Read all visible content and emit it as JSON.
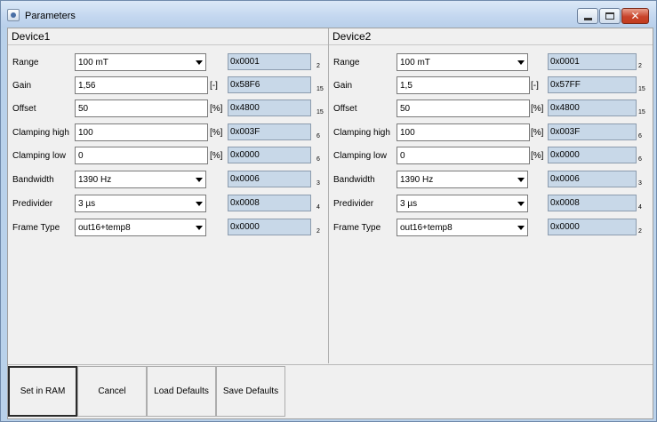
{
  "window": {
    "title": "Parameters",
    "controls": {
      "minimize": "minimize-icon",
      "maximize": "maximize-icon",
      "close": "close-icon"
    }
  },
  "devices": [
    {
      "title": "Device1",
      "rows": [
        {
          "label": "Range",
          "type": "select",
          "value": "100 mT",
          "unit": "",
          "hex": "0x0001",
          "bits": "2"
        },
        {
          "label": "Gain",
          "type": "input",
          "value": "1,56",
          "unit": "[-]",
          "hex": "0x58F6",
          "bits": "15"
        },
        {
          "label": "Offset",
          "type": "input",
          "value": "50",
          "unit": "[%]",
          "hex": "0x4800",
          "bits": "15"
        },
        {
          "label": "Clamping high",
          "type": "input",
          "value": "100",
          "unit": "[%]",
          "hex": "0x003F",
          "bits": "6"
        },
        {
          "label": "Clamping low",
          "type": "input",
          "value": "0",
          "unit": "[%]",
          "hex": "0x0000",
          "bits": "6"
        },
        {
          "label": "Bandwidth",
          "type": "select",
          "value": "1390 Hz",
          "unit": "",
          "hex": "0x0006",
          "bits": "3"
        },
        {
          "label": "Predivider",
          "type": "select",
          "value": "3 µs",
          "unit": "",
          "hex": "0x0008",
          "bits": "4"
        },
        {
          "label": "Frame Type",
          "type": "select",
          "value": "out16+temp8",
          "unit": "",
          "hex": "0x0000",
          "bits": "2"
        }
      ]
    },
    {
      "title": "Device2",
      "rows": [
        {
          "label": "Range",
          "type": "select",
          "value": "100 mT",
          "unit": "",
          "hex": "0x0001",
          "bits": "2"
        },
        {
          "label": "Gain",
          "type": "input",
          "value": "1,5",
          "unit": "[-]",
          "hex": "0x57FF",
          "bits": "15"
        },
        {
          "label": "Offset",
          "type": "input",
          "value": "50",
          "unit": "[%]",
          "hex": "0x4800",
          "bits": "15"
        },
        {
          "label": "Clamping high",
          "type": "input",
          "value": "100",
          "unit": "[%]",
          "hex": "0x003F",
          "bits": "6"
        },
        {
          "label": "Clamping low",
          "type": "input",
          "value": "0",
          "unit": "[%]",
          "hex": "0x0000",
          "bits": "6"
        },
        {
          "label": "Bandwidth",
          "type": "select",
          "value": "1390 Hz",
          "unit": "",
          "hex": "0x0006",
          "bits": "3"
        },
        {
          "label": "Predivider",
          "type": "select",
          "value": "3 µs",
          "unit": "",
          "hex": "0x0008",
          "bits": "4"
        },
        {
          "label": "Frame Type",
          "type": "select",
          "value": "out16+temp8",
          "unit": "",
          "hex": "0x0000",
          "bits": "2"
        }
      ]
    }
  ],
  "buttons": {
    "set_in_ram": "Set in RAM",
    "cancel": "Cancel",
    "load_defaults": "Load Defaults",
    "save_defaults": "Save Defaults"
  }
}
